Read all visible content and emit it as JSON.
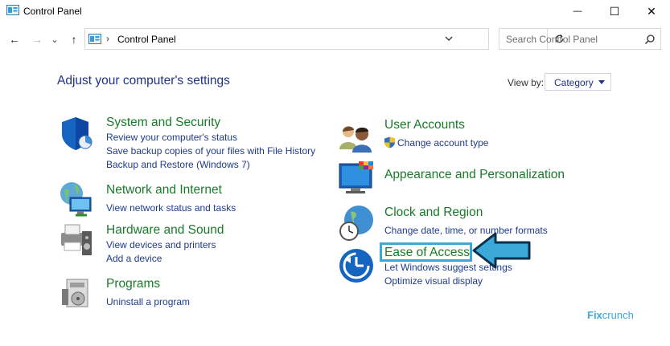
{
  "window": {
    "title": "Control Panel",
    "minimize_glyph": "—",
    "maximize_glyph": "☐",
    "close_glyph": "✕"
  },
  "nav": {
    "back_glyph": "←",
    "forward_glyph": "→",
    "recent_glyph": "⌄",
    "up_glyph": "↑"
  },
  "address": {
    "separator": "›",
    "path": "Control Panel"
  },
  "search": {
    "placeholder": "Search Control Panel"
  },
  "content": {
    "heading": "Adjust your computer's settings",
    "view_by_label": "View by:",
    "view_by_value": "Category"
  },
  "categories_left": [
    {
      "title": "System and Security",
      "links": [
        "Review your computer's status",
        "Save backup copies of your files with File History",
        "Backup and Restore (Windows 7)"
      ]
    },
    {
      "title": "Network and Internet",
      "links": [
        "View network status and tasks"
      ]
    },
    {
      "title": "Hardware and Sound",
      "links": [
        "View devices and printers",
        "Add a device"
      ]
    },
    {
      "title": "Programs",
      "links": [
        "Uninstall a program"
      ]
    }
  ],
  "categories_right": [
    {
      "title": "User Accounts",
      "links": [
        "Change account type"
      ]
    },
    {
      "title": "Appearance and Personalization",
      "links": []
    },
    {
      "title": "Clock and Region",
      "links": [
        "Change date, time, or number formats"
      ]
    },
    {
      "title": "Ease of Access",
      "links": [
        "Let Windows suggest settings",
        "Optimize visual display"
      ]
    }
  ],
  "watermark": {
    "part1": "Fix",
    "part2": "crunch"
  },
  "colors": {
    "heading": "#1e3287",
    "category_title": "#1a7a2a",
    "link": "#1e3b8c",
    "highlight": "#3aa8d8"
  }
}
